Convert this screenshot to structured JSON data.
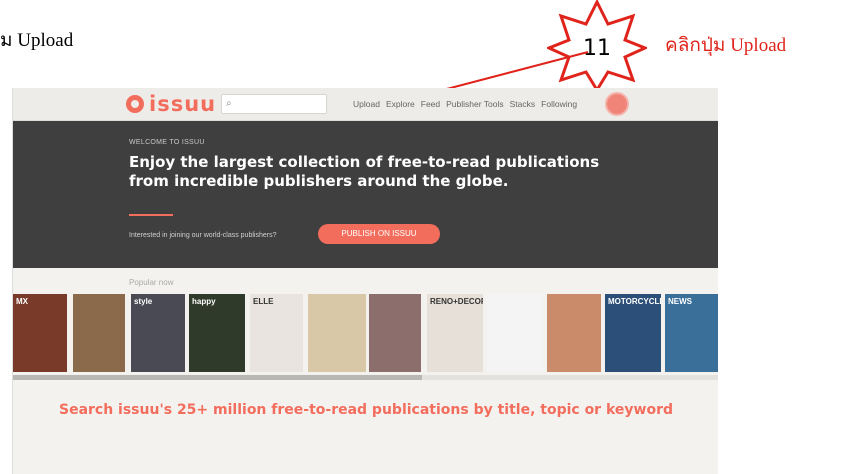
{
  "annotation": {
    "left_note": "ม Upload",
    "right_note": "คลิกปุ่ม Upload",
    "step_number": "11",
    "colors": {
      "note": "#e0241b",
      "star_fill": "#ffffff",
      "star_stroke": "#e0241b"
    }
  },
  "issuu": {
    "logo_text": "issuu",
    "search": {
      "placeholder": "",
      "icon": "search-icon"
    },
    "nav": [
      "Upload",
      "Explore",
      "Feed",
      "Publisher Tools",
      "Stacks",
      "Following"
    ],
    "hero": {
      "eyebrow": "WELCOME TO ISSUU",
      "headline": "Enjoy the largest collection of free-to-read publications from incredible publishers around the globe.",
      "invite": "Interested in joining our world-class publishers?",
      "publish_button": "PUBLISH ON ISSUU"
    },
    "popular_label": "Popular now",
    "covers": [
      {
        "label": "MX",
        "bg": "#7a3a2a"
      },
      {
        "label": "",
        "bg": "#8a6a4a"
      },
      {
        "label": "style",
        "bg": "#4a4a55"
      },
      {
        "label": "happy",
        "bg": "#2f3a2a"
      },
      {
        "label": "ELLE",
        "bg": "#e9e4df"
      },
      {
        "label": "",
        "bg": "#d8c8a8"
      },
      {
        "label": "",
        "bg": "#8c6f6c"
      },
      {
        "label": "RENO+DECOR",
        "bg": "#e6e0d8"
      },
      {
        "label": "",
        "bg": "#f4f4f4"
      },
      {
        "label": "",
        "bg": "#c98b6a"
      },
      {
        "label": "MOTORCYCLE",
        "bg": "#2b4f78"
      },
      {
        "label": "NEWS",
        "bg": "#3a6f9a"
      }
    ],
    "search_cta": "Search issuu's 25+ million free-to-read publications by title, topic or keyword",
    "accent_color": "#f36d5d",
    "scroll_position": 0.58
  }
}
